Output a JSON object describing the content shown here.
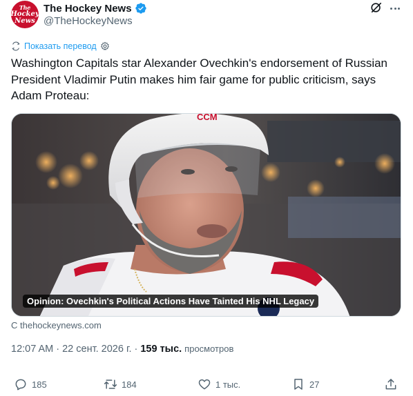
{
  "author": {
    "display_name": "The Hockey News",
    "handle": "@TheHockeyNews",
    "avatar_text": [
      "The",
      "Hockey",
      "News"
    ],
    "verified_icon": "verified-badge-icon",
    "brand_color": "#c8102e"
  },
  "header_actions": {
    "grok_icon": "grok-icon",
    "more_icon": "more-dots-icon"
  },
  "translate": {
    "label": "Показать перевод",
    "icon": "translate-icon",
    "settings_icon": "gear-icon"
  },
  "tweet": {
    "text": "Washington Capitals star Alexander Ovechkin's endorsement of Russian President Vladimir Putin makes him fair game for public criticism, says Adam Proteau:"
  },
  "card": {
    "caption": "Opinion: Ovechkin's Political Actions Have Tainted His NHL Legacy",
    "helmet_logo": "CCM",
    "source": "С thehockeynews.com"
  },
  "meta": {
    "time": "12:07 AM",
    "separator": "·",
    "date": "22 сент. 2026 г.",
    "dot": "·",
    "views_count": "159 тыс.",
    "views_label": "просмотров"
  },
  "actions": {
    "replies": "185",
    "reposts": "184",
    "likes": "1 тыс.",
    "bookmarks": "27",
    "share_icon": "share-icon"
  },
  "colors": {
    "text": "#0f1419",
    "secondary": "#536471",
    "link": "#1d9bf0",
    "verified": "#1d9bf0"
  }
}
